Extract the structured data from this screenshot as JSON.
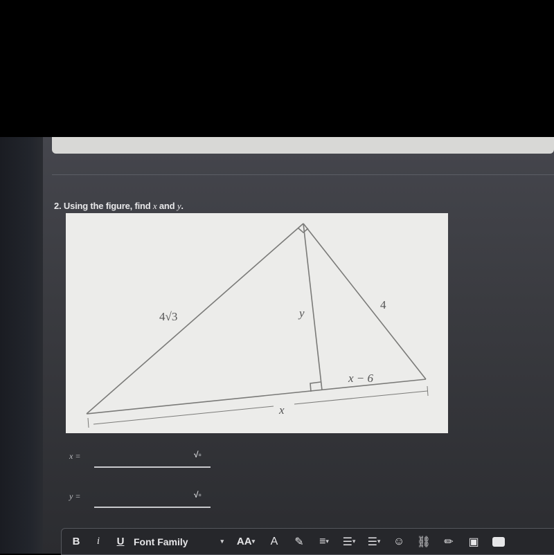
{
  "question": {
    "number": "2.",
    "text_prefix": "Using the figure, find ",
    "var1": "x",
    "joiner": " and ",
    "var2": "y",
    "suffix": "."
  },
  "figure": {
    "labels": {
      "left_hypotenuse": "4√3",
      "altitude": "y",
      "right_side": "4",
      "right_segment": "x − 6",
      "base": "x"
    },
    "right_angle_markers": [
      "apex",
      "altitude-foot"
    ]
  },
  "answers": [
    {
      "label": "x =",
      "value": "",
      "icon": "sqrt-icon",
      "icon_glyph": "√▫"
    },
    {
      "label": "y =",
      "value": "",
      "icon": "sqrt-icon",
      "icon_glyph": "√▫"
    }
  ],
  "toolbar": {
    "bold": "B",
    "italic": "i",
    "underline": "U",
    "font_family": "Font Family",
    "font_size": "AA",
    "text_color_icon": "A",
    "highlight_icon": "✎",
    "align_icon": "≡",
    "ordered_list_icon": "☰",
    "unordered_list_icon": "☰",
    "emoji_icon": "☺",
    "link_icon": "⛓",
    "pencil_icon": "✏",
    "image_icon": "▣",
    "caret": "▾"
  },
  "colors": {
    "figure_bg": "#ececea",
    "line": "#7a7a78",
    "toolbar_bg": "#26272b",
    "page_bg": "#3a3b40"
  }
}
